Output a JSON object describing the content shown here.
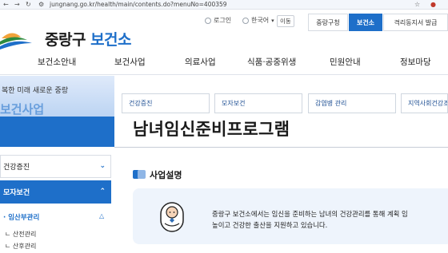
{
  "browser": {
    "url": "jungnang.go.kr/health/main/contents.do?menuNo=400359"
  },
  "header": {
    "logo_name": "중랑구",
    "logo_sub": "보건소",
    "utility": {
      "login": "로그인",
      "language": "한국어",
      "lang_button": "이동"
    },
    "top_tabs": [
      {
        "label": "중랑구청",
        "active": false
      },
      {
        "label": "보건소",
        "active": true
      },
      {
        "label": "격리동지서 발급",
        "active": false
      }
    ],
    "gnb": [
      "보건소안내",
      "보건사업",
      "의료사업",
      "식품·공중위생",
      "민원안내",
      "정보마당"
    ]
  },
  "sidebar": {
    "slogan": "복한 미래 새로운 중랑",
    "hero_faded": "보건사업",
    "items": [
      {
        "label": "건강증진",
        "open": false
      },
      {
        "label": "모자보건",
        "open": true
      }
    ],
    "sub_active": "· 임산부관리",
    "sub_items": [
      "ㄴ 산전관리",
      "ㄴ 산후관리"
    ]
  },
  "content_tabs": [
    "건강증진",
    "모자보건",
    "감염병 관리",
    "지역사회건강조"
  ],
  "page": {
    "title": "남녀임신준비프로그램",
    "section_title": "사업설명",
    "description_line1": "중랑구 보건소에서는 임신을 준비하는 남녀의 건강관리를 통해 계획 임",
    "description_line2": "높이고 건강한 출산을 지원하고 있습니다."
  },
  "colors": {
    "accent": "#1e6fc9",
    "box_bg": "#eef4fc"
  }
}
